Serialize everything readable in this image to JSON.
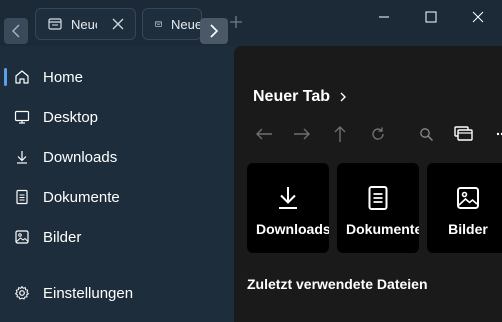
{
  "tabs": [
    {
      "label": "Neuer Tab",
      "icon": "tab-window-icon"
    },
    {
      "label": "Neuer Tab",
      "icon": "tab-window-icon"
    }
  ],
  "sidebar": {
    "items": [
      {
        "label": "Home",
        "icon": "home-icon"
      },
      {
        "label": "Desktop",
        "icon": "desktop-icon"
      },
      {
        "label": "Downloads",
        "icon": "download-icon"
      },
      {
        "label": "Dokumente",
        "icon": "document-icon"
      },
      {
        "label": "Bilder",
        "icon": "image-icon"
      }
    ],
    "settings_label": "Einstellungen"
  },
  "main": {
    "breadcrumb": "Neuer Tab",
    "cards": [
      {
        "label": "Downloads",
        "icon": "download-icon"
      },
      {
        "label": "Dokumente",
        "icon": "document-icon"
      },
      {
        "label": "Bilder",
        "icon": "image-icon"
      }
    ],
    "recent_heading": "Zuletzt verwendete Dateien"
  },
  "colors": {
    "sidebar_bg": "#1d2d3c",
    "main_bg": "#1a1a1a",
    "card_bg": "#000000",
    "accent": "#5aa0e6"
  }
}
